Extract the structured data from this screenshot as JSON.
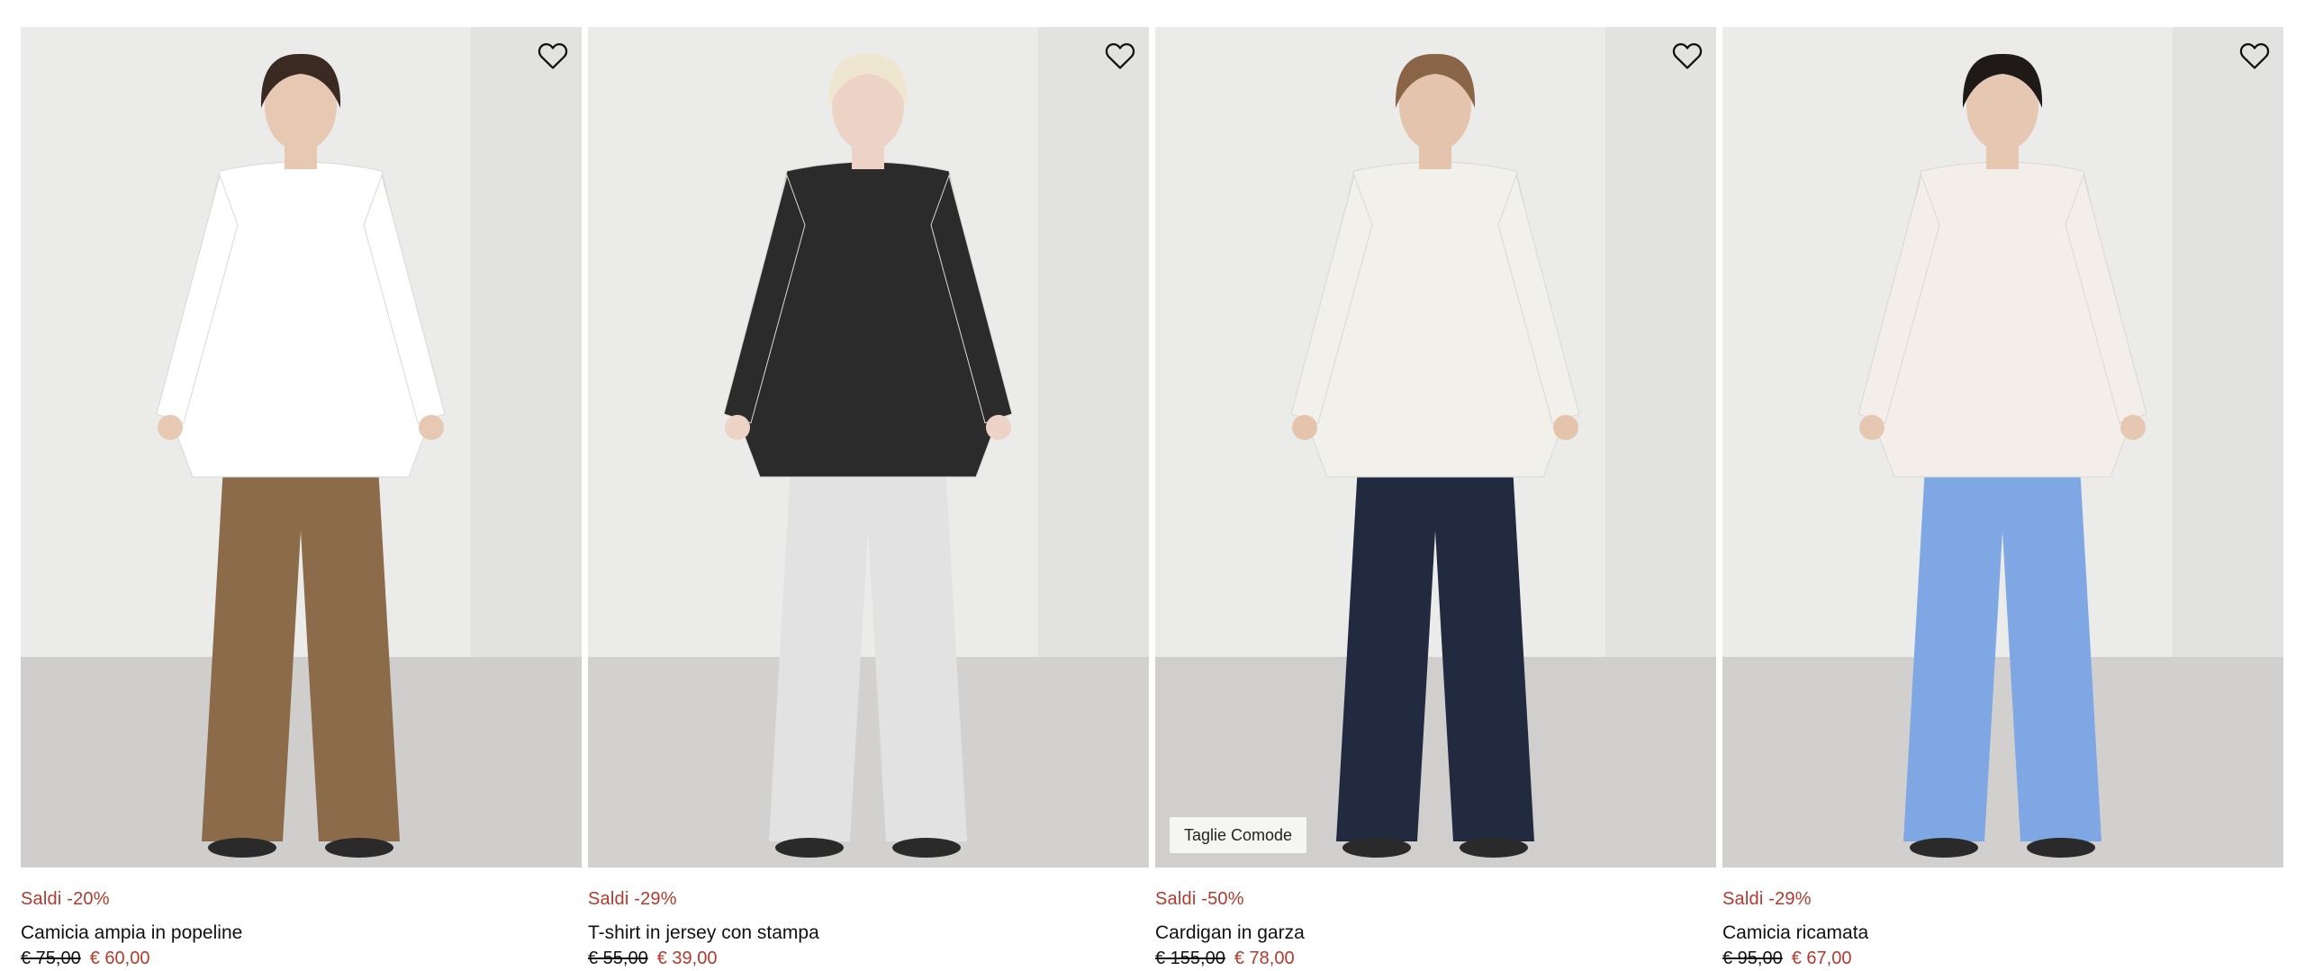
{
  "products": [
    {
      "sale": "Saldi -20%",
      "name": "Camicia ampia in popeline",
      "old_price": "€ 75,00",
      "new_price": "€ 60,00",
      "badge": "",
      "photo": {
        "top": "#ffffff",
        "bottom": "#8b6b49",
        "skin": "#e7c9b3",
        "hair": "#3b2a22",
        "bg": "#ebebea",
        "floor": "#cfcecc"
      }
    },
    {
      "sale": "Saldi -29%",
      "name": "T-shirt in jersey con stampa",
      "old_price": "€ 55,00",
      "new_price": "€ 39,00",
      "badge": "",
      "photo": {
        "top": "#2b2b2b",
        "bottom": "#e2e2e2",
        "skin": "#ecd3c5",
        "hair": "#efe6cf",
        "bg": "#ebebea",
        "floor": "#d2d1cf"
      }
    },
    {
      "sale": "Saldi -50%",
      "name": "Cardigan in garza",
      "old_price": "€ 155,00",
      "new_price": "€ 78,00",
      "badge": "Taglie Comode",
      "photo": {
        "top": "#f1f0ea",
        "bottom": "#222a3f",
        "skin": "#e5c4ad",
        "hair": "#8a6446",
        "bg": "#ebebea",
        "floor": "#d0cfcd"
      }
    },
    {
      "sale": "Saldi -29%",
      "name": "Camicia ricamata",
      "old_price": "€ 95,00",
      "new_price": "€ 67,00",
      "badge": "",
      "photo": {
        "top": "#f4eeea",
        "bottom": "#7ea7e4",
        "skin": "#e6c8b2",
        "hair": "#1f1a17",
        "bg": "#ebebea",
        "floor": "#d1d0ce"
      }
    }
  ]
}
